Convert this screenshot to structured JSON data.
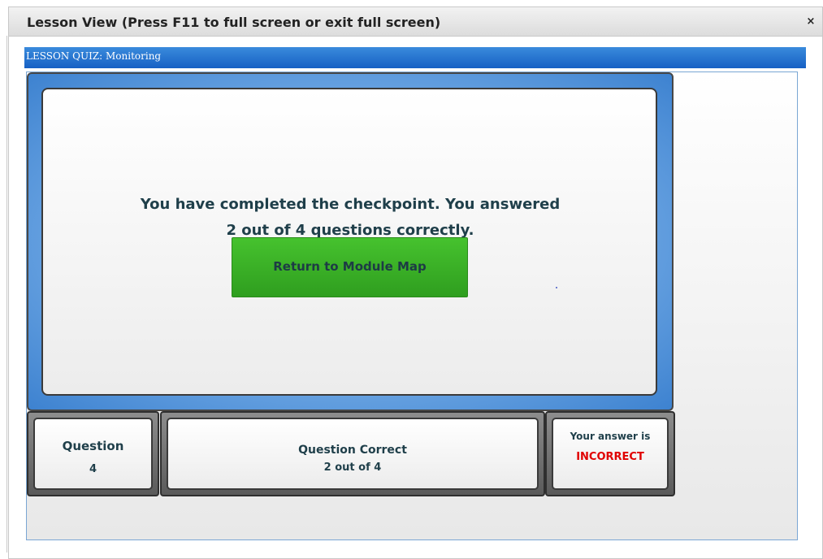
{
  "window": {
    "title": "Lesson View (Press F11 to full screen or exit full screen)",
    "close_label": "×"
  },
  "lesson": {
    "header": "LESSON QUIZ: Monitoring"
  },
  "result": {
    "line1": "You have completed the checkpoint. You answered",
    "line2": "2 out of 4 questions correctly.",
    "return_button": "Return to Module Map"
  },
  "stats": {
    "question_label": "Question",
    "question_value": "4",
    "correct_label": "Question Correct",
    "correct_value": "2 out of 4",
    "answer_label": "Your answer is",
    "answer_value": "INCORRECT"
  },
  "colors": {
    "header_blue": "#1660c4",
    "button_green": "#3aaf26",
    "incorrect_red": "#e00000",
    "text_dark": "#1f3f4a"
  }
}
